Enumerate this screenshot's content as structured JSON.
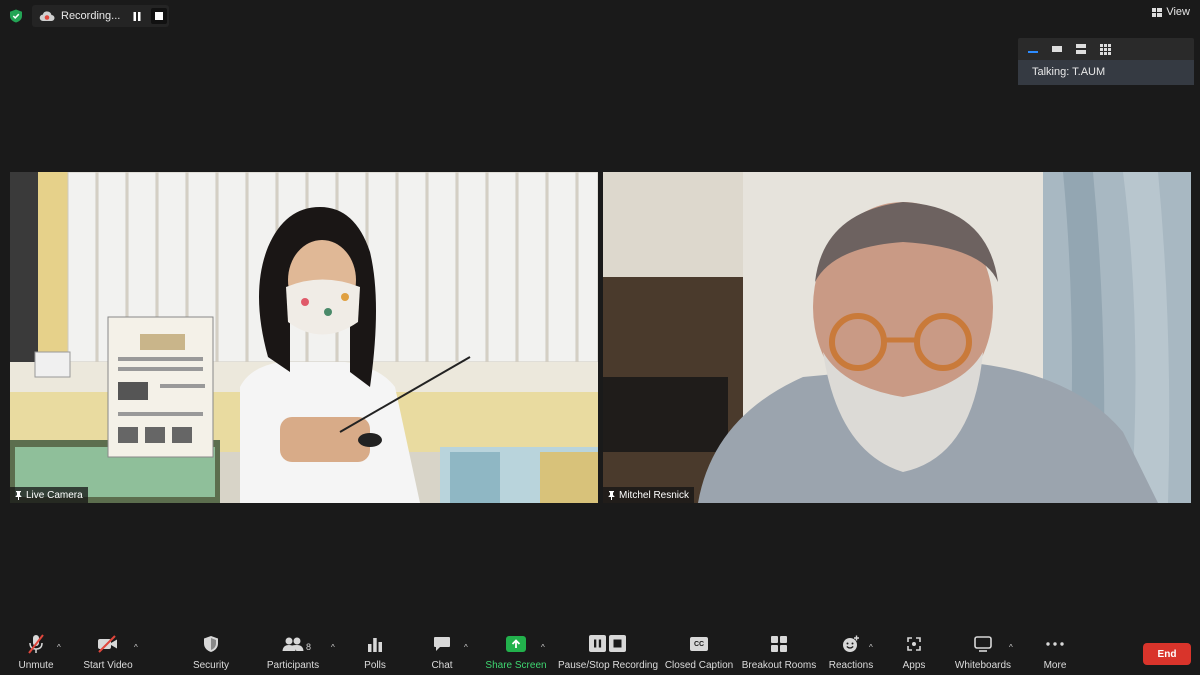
{
  "top_bar": {
    "recording_label": "Recording...",
    "view_label": "View"
  },
  "speaker_panel": {
    "talking_label": "Talking: T.AUM"
  },
  "videos": [
    {
      "name": "Live Camera"
    },
    {
      "name": "Mitchel Resnick"
    }
  ],
  "toolbar": {
    "unmute": "Unmute",
    "start_video": "Start Video",
    "security": "Security",
    "participants": "Participants",
    "participant_count": "8",
    "polls": "Polls",
    "chat": "Chat",
    "share_screen": "Share Screen",
    "pause_stop_recording": "Pause/Stop Recording",
    "closed_caption": "Closed Caption",
    "cc_icon_text": "CC",
    "breakout_rooms": "Breakout Rooms",
    "reactions": "Reactions",
    "apps": "Apps",
    "whiteboards": "Whiteboards",
    "more": "More",
    "end": "End"
  },
  "colors": {
    "background": "#1a1a1a",
    "share_green": "#22b14c",
    "end_red": "#d9342b",
    "active_blue": "#2d8cff",
    "muted_red": "#e0463c"
  }
}
